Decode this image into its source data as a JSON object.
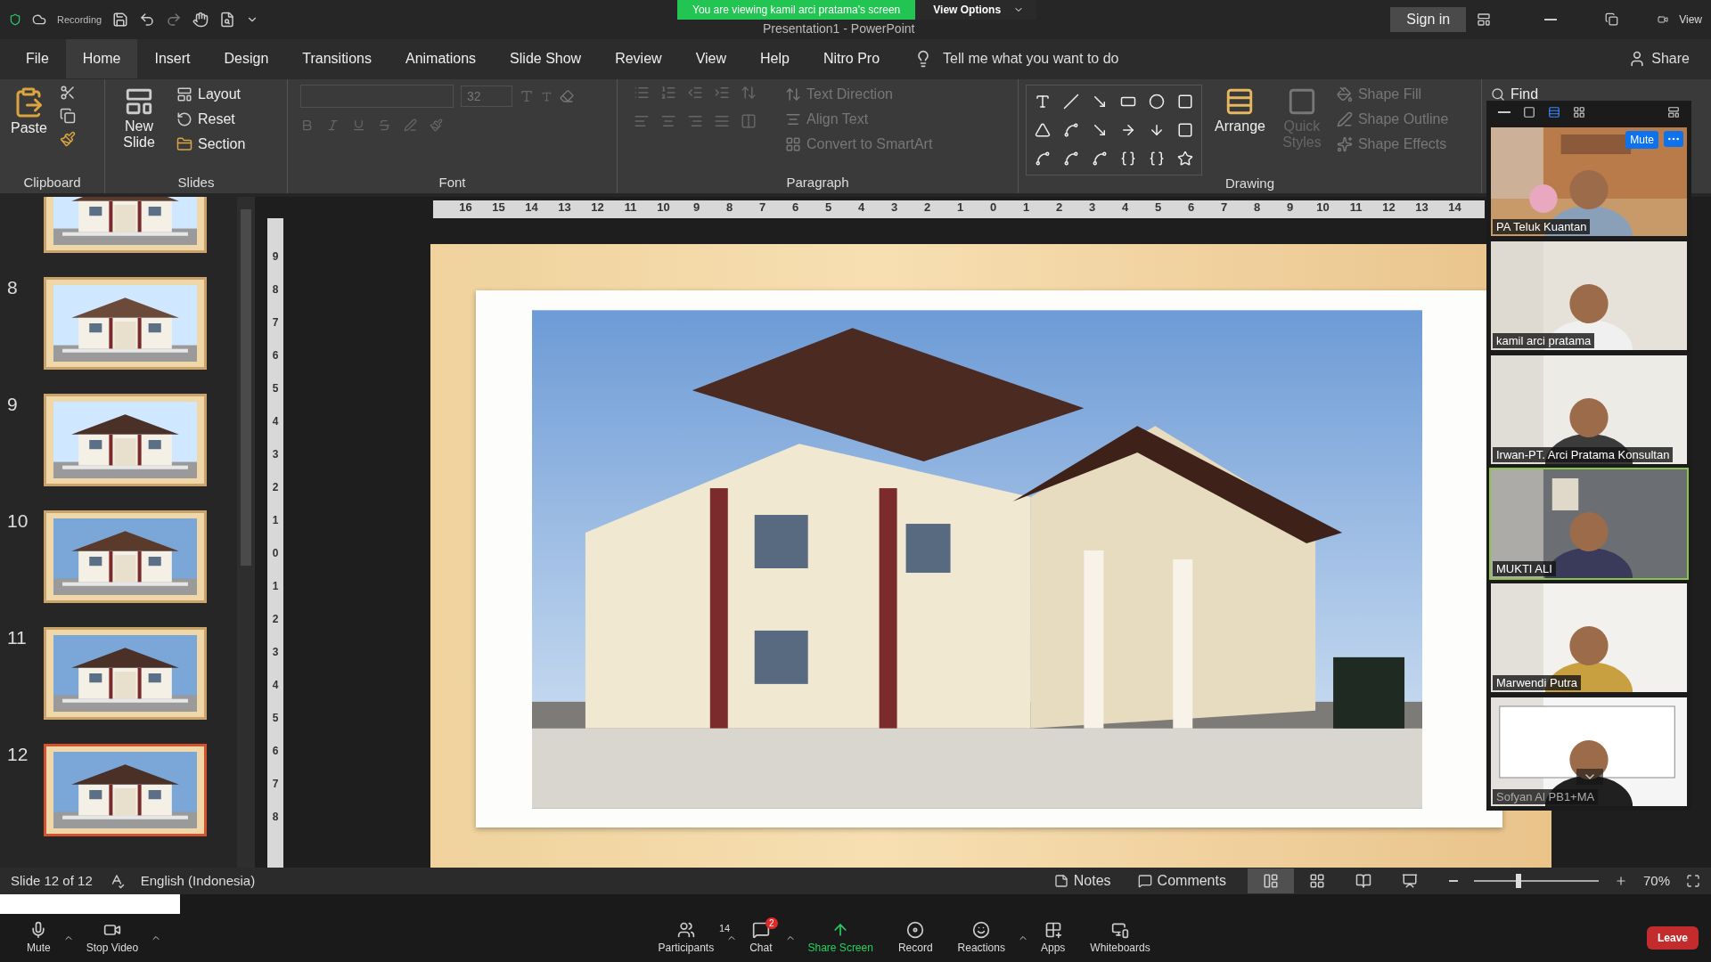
{
  "zoom_banner": {
    "message": "You are viewing kamil arci pratama's screen",
    "view_options": "View Options"
  },
  "recording": "Recording",
  "window": {
    "title": "Presentation1 - PowerPoint",
    "sign_in": "Sign in",
    "view": "View"
  },
  "menu_tabs": [
    {
      "label": "File",
      "selected": false
    },
    {
      "label": "Home",
      "selected": true
    },
    {
      "label": "Insert",
      "selected": false
    },
    {
      "label": "Design",
      "selected": false
    },
    {
      "label": "Transitions",
      "selected": false
    },
    {
      "label": "Animations",
      "selected": false
    },
    {
      "label": "Slide Show",
      "selected": false
    },
    {
      "label": "Review",
      "selected": false
    },
    {
      "label": "View",
      "selected": false
    },
    {
      "label": "Help",
      "selected": false
    },
    {
      "label": "Nitro Pro",
      "selected": false
    }
  ],
  "tell_me": "Tell me what you want to do",
  "share": "Share",
  "ribbon": {
    "clipboard": {
      "paste": "Paste",
      "label": "Clipboard"
    },
    "slides": {
      "new_slide": "New Slide",
      "layout": "Layout",
      "reset": "Reset",
      "section": "Section",
      "label": "Slides"
    },
    "font": {
      "size": "32",
      "label": "Font"
    },
    "paragraph": {
      "text_direction": "Text Direction",
      "align_text": "Align Text",
      "convert": "Convert to SmartArt",
      "label": "Paragraph"
    },
    "drawing": {
      "arrange": "Arrange",
      "quick_styles": "Quick Styles",
      "shape_fill": "Shape Fill",
      "shape_outline": "Shape Outline",
      "shape_effects": "Shape Effects",
      "label": "Drawing"
    },
    "editing": {
      "find": "Find"
    }
  },
  "ruler": {
    "horizontal": [
      "16",
      "15",
      "14",
      "13",
      "12",
      "11",
      "10",
      "9",
      "8",
      "7",
      "6",
      "5",
      "4",
      "3",
      "2",
      "1",
      "0",
      "1",
      "2",
      "3",
      "4",
      "5",
      "6",
      "7",
      "8",
      "9",
      "10",
      "11",
      "12",
      "13",
      "14"
    ],
    "vertical": [
      "9",
      "8",
      "7",
      "6",
      "5",
      "4",
      "3",
      "2",
      "1",
      "0",
      "1",
      "2",
      "3",
      "4",
      "5",
      "6",
      "7",
      "8"
    ]
  },
  "thumbnails": [
    {
      "selected": false
    },
    {
      "number": "8",
      "selected": false
    },
    {
      "number": "9",
      "selected": false
    },
    {
      "number": "10",
      "selected": false
    },
    {
      "number": "11",
      "selected": false
    },
    {
      "number": "12",
      "selected": true
    }
  ],
  "video_panel": {
    "mute": "Mute",
    "tiles": [
      {
        "name": "PA Teluk Kuantan",
        "active_speaker": false
      },
      {
        "name": "kamil arci pratama",
        "active_speaker": false
      },
      {
        "name": "Irwan-PT. Arci Pratama Konsultan",
        "active_speaker": false
      },
      {
        "name": "MUKTI ALI",
        "active_speaker": true
      },
      {
        "name": "Marwendi Putra",
        "active_speaker": false
      },
      {
        "name": "Sofyan Al PB1+MA",
        "active_speaker": false
      }
    ]
  },
  "status_bar": {
    "slide": "Slide 12 of 12",
    "language": "English (Indonesia)",
    "notes": "Notes",
    "comments": "Comments",
    "view_buttons": [
      {
        "kind": "normal",
        "selected": true
      },
      {
        "kind": "sorter",
        "selected": false
      },
      {
        "kind": "reading",
        "selected": false
      },
      {
        "kind": "slideshow",
        "selected": false
      }
    ],
    "zoom_slider": {
      "level": 0.36
    },
    "zoom": "70%"
  },
  "meeting_toolbar": {
    "left": [
      {
        "kind": "mic",
        "label": "Mute"
      },
      {
        "kind": "video",
        "label": "Stop Video"
      }
    ],
    "center": [
      {
        "kind": "participants",
        "label": "Participants",
        "count": "14"
      },
      {
        "kind": "chat",
        "label": "Chat",
        "badge": "2"
      },
      {
        "kind": "share",
        "label": "Share Screen"
      },
      {
        "kind": "record",
        "label": "Record"
      },
      {
        "kind": "reactions",
        "label": "Reactions"
      },
      {
        "kind": "apps",
        "label": "Apps"
      },
      {
        "kind": "whiteboards",
        "label": "Whiteboards"
      }
    ],
    "leave": "Leave"
  }
}
